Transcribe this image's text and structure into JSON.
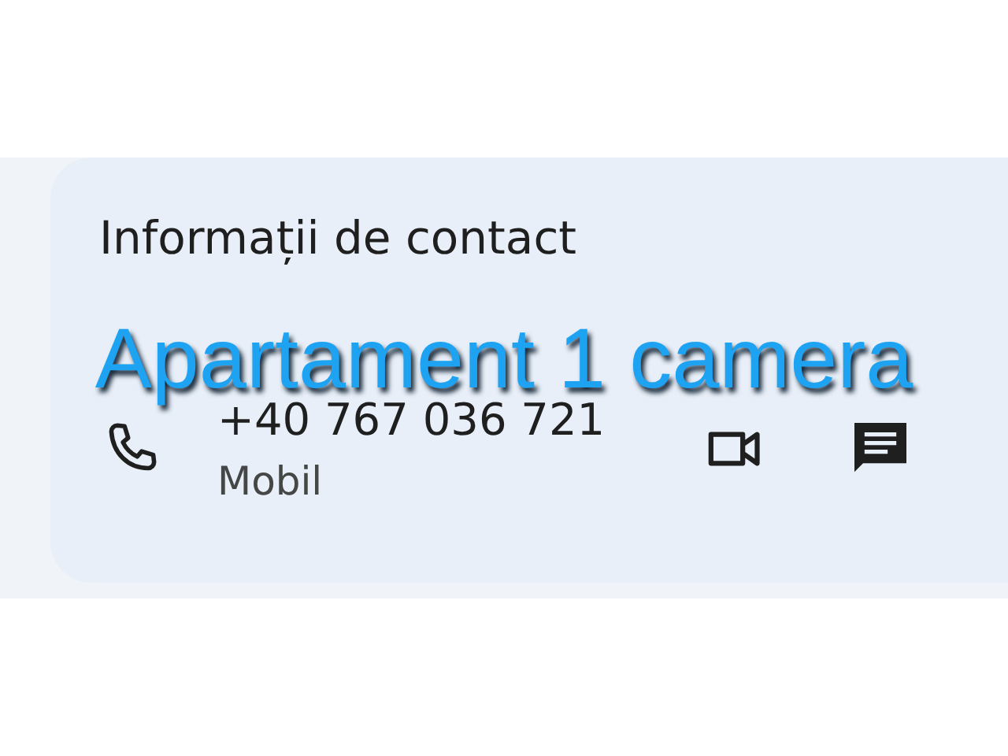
{
  "card": {
    "title": "Informații de contact",
    "phone": {
      "number": "+40 767 036 721",
      "label": "Mobil"
    }
  },
  "caption": "Apartament 1 camera"
}
